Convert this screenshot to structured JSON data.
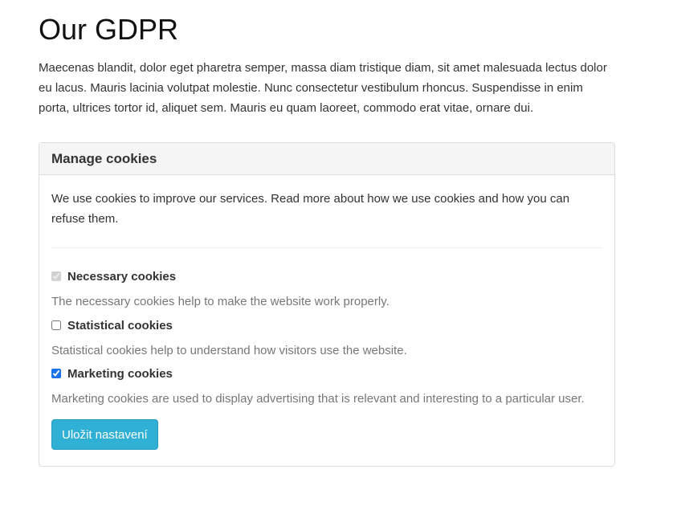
{
  "page": {
    "title": "Our GDPR",
    "intro": "Maecenas blandit, dolor eget pharetra semper, massa diam tristique diam, sit amet malesuada lectus dolor eu lacus. Mauris lacinia volutpat molestie. Nunc consectetur vestibulum rhoncus. Suspendisse in enim porta, ultrices tortor id, aliquet sem. Mauris eu quam laoreet, commodo erat vitae, ornare dui."
  },
  "cookies_panel": {
    "heading": "Manage cookies",
    "description": "We use cookies to improve our services. Read more about how we use cookies and how you can refuse them.",
    "options": [
      {
        "label": "Necessary cookies",
        "help": "The necessary cookies help to make the website work properly.",
        "checked": true,
        "disabled": true
      },
      {
        "label": "Statistical cookies",
        "help": "Statistical cookies help to understand how visitors use the website.",
        "checked": false,
        "disabled": false
      },
      {
        "label": "Marketing cookies",
        "help": "Marketing cookies are used to display advertising that is relevant and interesting to a particular user.",
        "checked": true,
        "disabled": false
      }
    ],
    "save_button": "Uložit nastavení"
  },
  "colors": {
    "button_bg": "#31b0d5",
    "checkbox_accent": "#1a73e8",
    "help_text": "#777777"
  }
}
